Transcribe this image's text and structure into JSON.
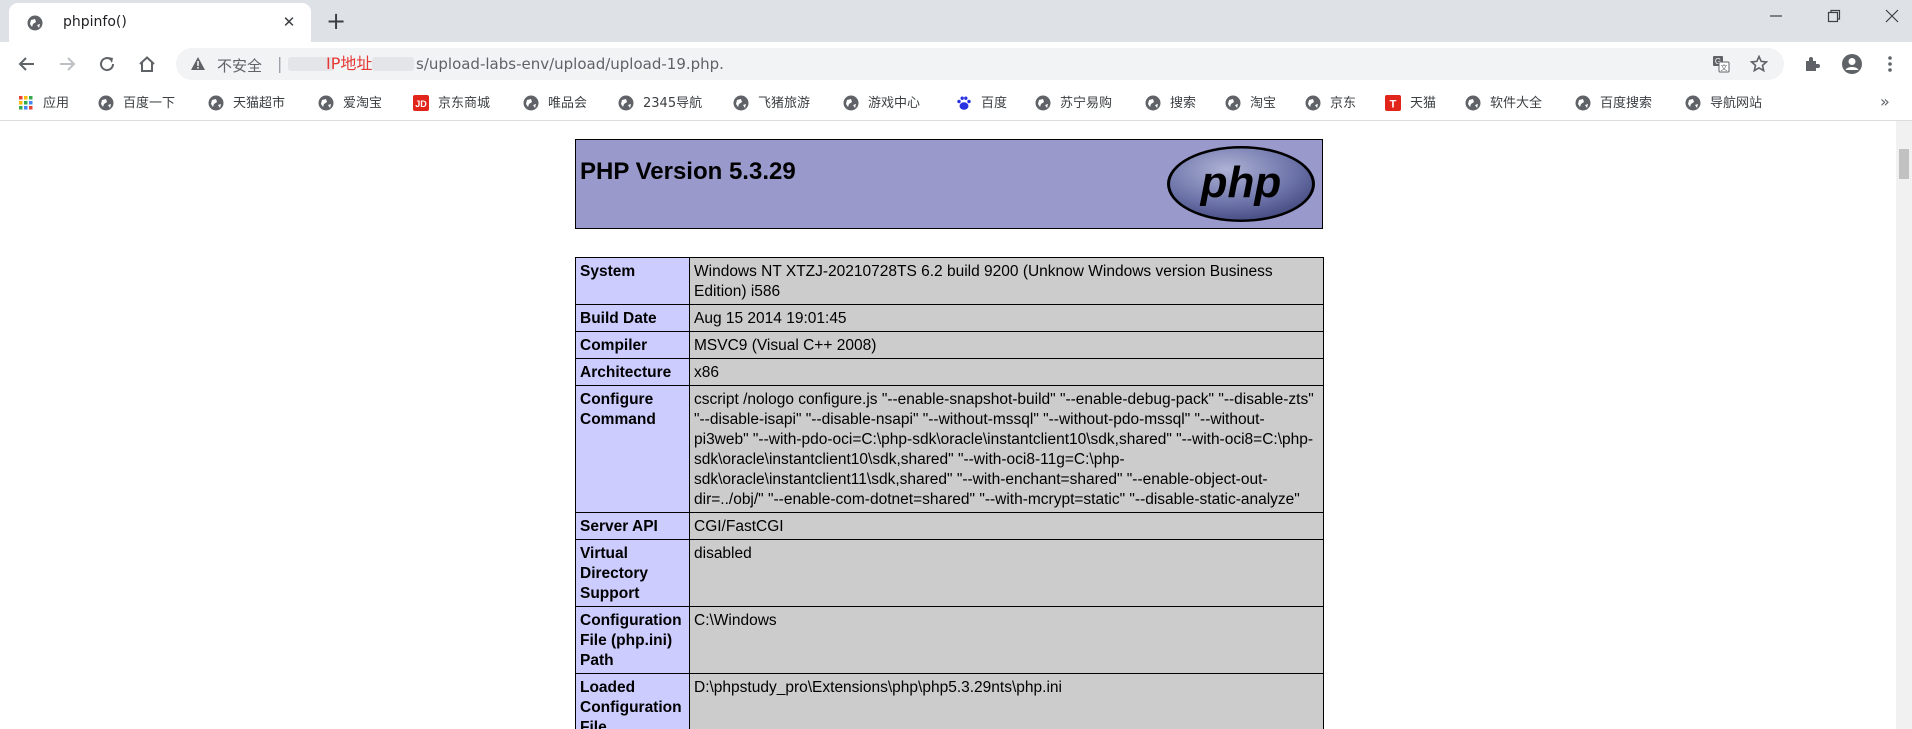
{
  "browser": {
    "tab": {
      "title": "phpinfo()"
    },
    "address": {
      "insecure_label": "不安全",
      "separator": "|",
      "ip_annotation": "IP地址",
      "path": "s/upload-labs-env/upload/upload-19.php."
    },
    "bookmarks": [
      {
        "label": "应用",
        "icon": "apps-grid-icon"
      },
      {
        "label": "百度一下",
        "icon": "globe-icon"
      },
      {
        "label": "天猫超市",
        "icon": "globe-icon"
      },
      {
        "label": "爱淘宝",
        "icon": "globe-icon"
      },
      {
        "label": "京东商城",
        "icon": "jd-logo-icon"
      },
      {
        "label": "唯品会",
        "icon": "globe-icon"
      },
      {
        "label": "2345导航",
        "icon": "globe-icon"
      },
      {
        "label": "飞猪旅游",
        "icon": "globe-icon"
      },
      {
        "label": "游戏中心",
        "icon": "globe-icon"
      },
      {
        "label": "百度",
        "icon": "baidu-paw-icon"
      },
      {
        "label": "苏宁易购",
        "icon": "globe-icon"
      },
      {
        "label": "搜索",
        "icon": "globe-icon"
      },
      {
        "label": "淘宝",
        "icon": "globe-icon"
      },
      {
        "label": "京东",
        "icon": "globe-icon"
      },
      {
        "label": "天猫",
        "icon": "tmall-logo-icon"
      },
      {
        "label": "软件大全",
        "icon": "globe-icon"
      },
      {
        "label": "百度搜索",
        "icon": "globe-icon"
      },
      {
        "label": "导航网站",
        "icon": "globe-icon"
      }
    ],
    "bookmarks_more": "»"
  },
  "php": {
    "version_title": "PHP Version 5.3.29",
    "logo_text": "php",
    "rows": [
      {
        "key": "System",
        "value": "Windows NT XTZJ-20210728TS 6.2 build 9200 (Unknow Windows version Business Edition) i586"
      },
      {
        "key": "Build Date",
        "value": "Aug 15 2014 19:01:45"
      },
      {
        "key": "Compiler",
        "value": "MSVC9 (Visual C++ 2008)"
      },
      {
        "key": "Architecture",
        "value": "x86"
      },
      {
        "key": "Configure Command",
        "value": "cscript /nologo configure.js \"--enable-snapshot-build\" \"--enable-debug-pack\" \"--disable-zts\" \"--disable-isapi\" \"--disable-nsapi\" \"--without-mssql\" \"--without-pdo-mssql\" \"--without-pi3web\" \"--with-pdo-oci=C:\\php-sdk\\oracle\\instantclient10\\sdk,shared\" \"--with-oci8=C:\\php-sdk\\oracle\\instantclient10\\sdk,shared\" \"--with-oci8-11g=C:\\php-sdk\\oracle\\instantclient11\\sdk,shared\" \"--with-enchant=shared\" \"--enable-object-out-dir=../obj/\" \"--enable-com-dotnet=shared\" \"--with-mcrypt=static\" \"--disable-static-analyze\""
      },
      {
        "key": "Server API",
        "value": "CGI/FastCGI"
      },
      {
        "key": "Virtual Directory Support",
        "value": "disabled"
      },
      {
        "key": "Configuration File (php.ini) Path",
        "value": "C:\\Windows"
      },
      {
        "key": "Loaded Configuration File",
        "value": "D:\\phpstudy_pro\\Extensions\\php\\php5.3.29nts\\php.ini"
      }
    ]
  }
}
